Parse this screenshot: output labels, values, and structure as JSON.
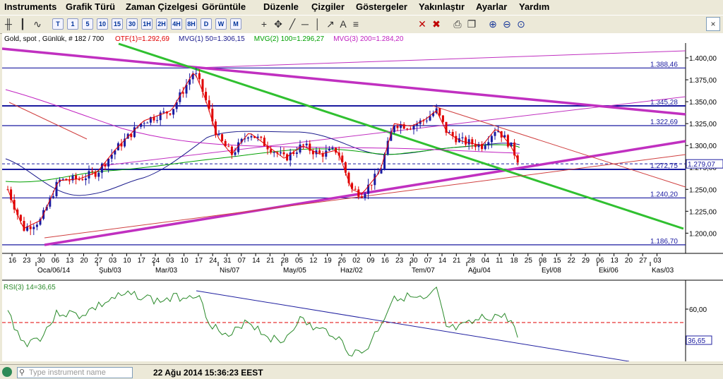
{
  "menu": {
    "items": [
      "Instruments",
      "Grafik Türü",
      "Zaman Çizelgesi",
      "Görüntüle",
      "Düzenle",
      "Çizgiler",
      "Göstergeler",
      "Yakınlaştır",
      "Ayarlar",
      "Yardım"
    ]
  },
  "toolbar": {
    "periods": [
      "T",
      "1",
      "5",
      "10",
      "15",
      "30",
      "1H",
      "2H",
      "4H",
      "8H",
      "D",
      "W",
      "M"
    ],
    "icons": [
      "bar-chart-icon",
      "candlestick-icon",
      "line-chart-icon",
      "crosshair-icon",
      "cursor-icon",
      "trendline-icon",
      "horizontal-line-icon",
      "vertical-line-icon",
      "arrow-icon",
      "text-icon",
      "fibonacci-icon",
      "delete-icon",
      "delete-all-icon",
      "print-icon",
      "copy-icon",
      "zoom-in-icon",
      "zoom-out-icon",
      "zoom-reset-icon"
    ],
    "close_label": "×"
  },
  "chart": {
    "header": "Gold, spot , Günlük, # 182 / 700",
    "indicators": [
      {
        "text": "OTF(1)=1.292,69",
        "color": "#e00000"
      },
      {
        "text": "MVG(1) 50=1.306,15",
        "color": "#1a1a8c"
      },
      {
        "text": "MVG(2) 100=1.296,27",
        "color": "#00a000"
      },
      {
        "text": "MVG(3) 200=1.284,20",
        "color": "#c020c0"
      }
    ],
    "price_axis": [
      "1.400,00",
      "1.375,00",
      "1.350,00",
      "1.325,00",
      "1.300,00",
      "1.275,00",
      "1.250,00",
      "1.225,00",
      "1.200,00"
    ],
    "level_labels": [
      "1.388,46",
      "1.345,28",
      "1.322,69",
      "1.272,75",
      "1.240,20",
      "1.186,70"
    ],
    "current_price": "1.279,07",
    "day_ticks": [
      "16",
      "23",
      "30",
      "06",
      "13",
      "20",
      "27",
      "03",
      "10",
      "17",
      "24",
      "03",
      "10",
      "17",
      "24",
      "31",
      "07",
      "14",
      "21",
      "28",
      "05",
      "12",
      "19",
      "26",
      "02",
      "09",
      "16",
      "23",
      "30",
      "07",
      "14",
      "21",
      "28",
      "04",
      "11",
      "18",
      "25",
      "08",
      "15",
      "22",
      "29",
      "06",
      "13",
      "20",
      "27",
      "03"
    ],
    "month_ticks": [
      "Oca/06/14",
      "Şub/03",
      "Mar/03",
      "Nis/07",
      "May/05",
      "Haz/02",
      "Tem/07",
      "Ağu/04",
      "Eyl/08",
      "Eki/06",
      "Kas/03"
    ]
  },
  "rsi": {
    "label": "RSI(3) 14=36,65",
    "axis": [
      "60,00",
      "40,00"
    ],
    "current": "36,65",
    "colors": {
      "line": "#2a8a2a",
      "level": "#e00000",
      "trend": "#2020a0"
    }
  },
  "status": {
    "search_placeholder": "Type instrument name",
    "datetime": "22 Ağu 2014 15:36:23 EEST"
  }
}
